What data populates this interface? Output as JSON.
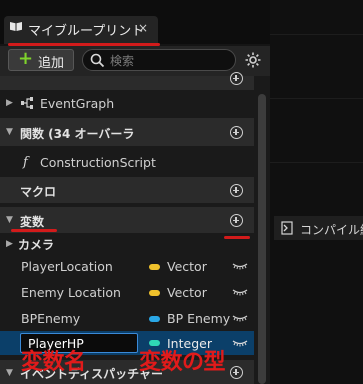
{
  "tab": {
    "title": "マイブループリント",
    "close": "×"
  },
  "toolbar": {
    "add_label": "追加",
    "search_placeholder": "検索"
  },
  "sections": {
    "event_graph": "EventGraph",
    "functions_header": "関数 (34 オーバーラ",
    "construction_script": "ConstructionScript",
    "macros_header": "マクロ",
    "variables_header": "変数",
    "camera_category": "カメラ",
    "dispatchers_header": "イベントディスパッチャー"
  },
  "variables": [
    {
      "name": "PlayerLocation",
      "type": "Vector",
      "type_color": "#f0c22c"
    },
    {
      "name": "Enemy Location",
      "type": "Vector",
      "type_color": "#f0c22c"
    },
    {
      "name": "BPEnemy",
      "type": "BP Enemy",
      "type_color": "#2aa7e6"
    },
    {
      "name": "PlayerHP",
      "type": "Integer",
      "type_color": "#2fd8b5"
    }
  ],
  "graph_panel": {
    "compile_label": "コンパイル結"
  },
  "annotations": {
    "variable_name": "変数名",
    "variable_type": "変数の型"
  },
  "colors": {
    "annotation_red": "#d21b1b",
    "add_green": "#7fd32c",
    "selection_blue": "#0b3f69"
  },
  "icons": [
    "book-icon",
    "close-icon",
    "plus-icon",
    "search-icon",
    "gear-icon",
    "event-graph-icon",
    "function-icon",
    "circle-plus-icon",
    "eye-icon",
    "compile-icon"
  ]
}
